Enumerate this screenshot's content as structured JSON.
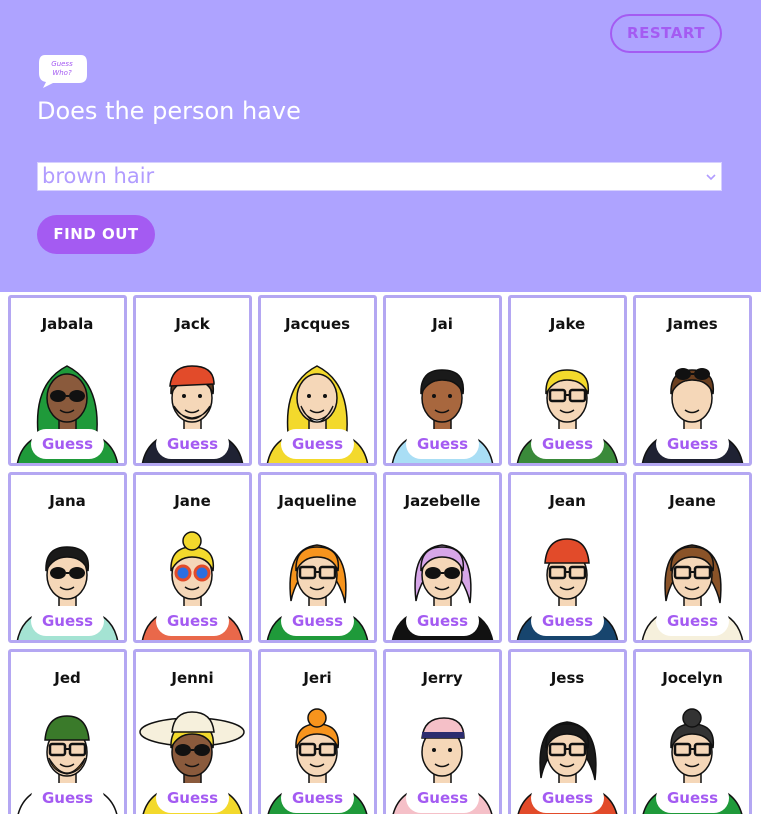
{
  "header": {
    "restart_label": "RESTART",
    "logo_text": "Guess Who?",
    "question": "Does the person have",
    "select_value": "brown hair",
    "find_out_label": "FIND OUT"
  },
  "colors": {
    "header_bg": "#aea3ff",
    "accent": "#a45bf2",
    "card_border": "#b4a7f2"
  },
  "guess_label": "Guess",
  "characters": [
    {
      "name": "Jabala",
      "skin": "#8a5a3c",
      "hair": "#1f9a3a",
      "shirt": "#1f9a3a",
      "glasses": "sun",
      "hat": "hood"
    },
    {
      "name": "Jack",
      "skin": "#f5d7b8",
      "hair": "#5b3a1e",
      "shirt": "#1f2233",
      "glasses": "none",
      "hat": "bandana"
    },
    {
      "name": "Jacques",
      "skin": "#f5d7b8",
      "hair": "#ffffff",
      "shirt": "#f3d92c",
      "glasses": "none",
      "hat": "hood-yellow"
    },
    {
      "name": "Jai",
      "skin": "#a8673e",
      "hair": "#1a1a1a",
      "shirt": "#a9def5",
      "glasses": "none",
      "hat": "none"
    },
    {
      "name": "Jake",
      "skin": "#f5d7b8",
      "hair": "#f3d92c",
      "shirt": "#3a8a3a",
      "glasses": "clear",
      "hat": "none"
    },
    {
      "name": "James",
      "skin": "#f5d7b8",
      "hair": "#6b3f1f",
      "shirt": "#1f2233",
      "glasses": "sun-top",
      "hat": "none"
    },
    {
      "name": "Jana",
      "skin": "#f5d7b8",
      "hair": "#1a1a1a",
      "shirt": "#a4e3d3",
      "glasses": "sun",
      "hat": "none"
    },
    {
      "name": "Jane",
      "skin": "#f5d7b8",
      "hair": "#f3d92c",
      "shirt": "#e9684a",
      "glasses": "colour",
      "hat": "none"
    },
    {
      "name": "Jaqueline",
      "skin": "#f5d7b8",
      "hair": "#f7941d",
      "shirt": "#1f9a3a",
      "glasses": "clear",
      "hat": "none"
    },
    {
      "name": "Jazebelle",
      "skin": "#f5d7b8",
      "hair": "#d7a6e8",
      "shirt": "#111111",
      "glasses": "sun",
      "hat": "none"
    },
    {
      "name": "Jean",
      "skin": "#f5d7b8",
      "hair": "#e24b2a",
      "shirt": "#17456e",
      "glasses": "clear",
      "hat": "beanie-red"
    },
    {
      "name": "Jeane",
      "skin": "#f5d7b8",
      "hair": "#8a5328",
      "shirt": "#f6f0dc",
      "glasses": "clear",
      "hat": "none"
    },
    {
      "name": "Jed",
      "skin": "#f5d7b8",
      "hair": "#f7941d",
      "shirt": "#ffffff",
      "glasses": "clear",
      "hat": "beanie-green"
    },
    {
      "name": "Jenni",
      "skin": "#8a5a3c",
      "hair": "#f3d92c",
      "shirt": "#f3d92c",
      "glasses": "sun",
      "hat": "sunhat"
    },
    {
      "name": "Jeri",
      "skin": "#f5d7b8",
      "hair": "#f7941d",
      "shirt": "#1f9a3a",
      "glasses": "clear",
      "hat": "none"
    },
    {
      "name": "Jerry",
      "skin": "#f5d7b8",
      "hair": "#f5c0c8",
      "shirt": "#f5c0c8",
      "glasses": "none",
      "hat": "cap"
    },
    {
      "name": "Jess",
      "skin": "#f5d7b8",
      "hair": "#1a1a1a",
      "shirt": "#e24b2a",
      "glasses": "clear",
      "hat": "none"
    },
    {
      "name": "Jocelyn",
      "skin": "#f5d7b8",
      "hair": "#333333",
      "shirt": "#1f9a3a",
      "glasses": "clear",
      "hat": "none"
    }
  ]
}
